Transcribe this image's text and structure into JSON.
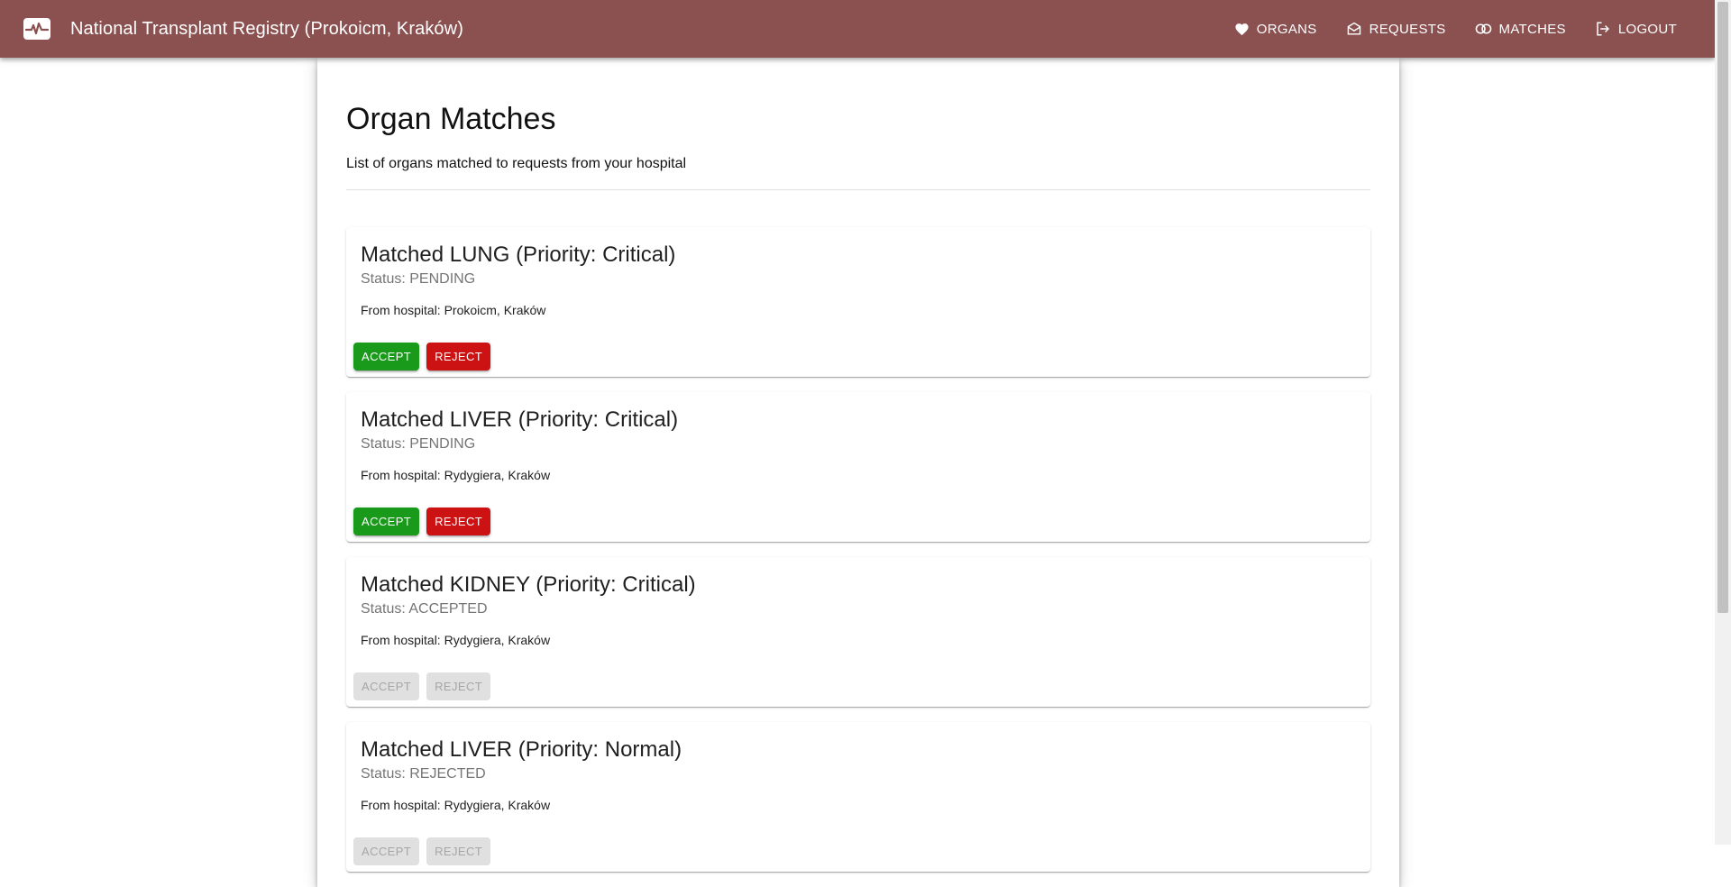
{
  "appbar": {
    "title": "National Transplant Registry (Prokoicm, Kraków)",
    "logo_icon": "heart-monitor-icon",
    "nav": [
      {
        "label": "ORGANS",
        "icon": "heart-icon"
      },
      {
        "label": "REQUESTS",
        "icon": "open-mail-icon"
      },
      {
        "label": "MATCHES",
        "icon": "matches-icon"
      },
      {
        "label": "LOGOUT",
        "icon": "logout-icon"
      }
    ],
    "color": "#8b5050"
  },
  "page": {
    "title": "Organ Matches",
    "subtitle": "List of organs matched to requests from your hospital"
  },
  "matches": [
    {
      "title": "Matched LUNG (Priority: Critical)",
      "status": "Status: PENDING",
      "hospital": "From hospital: Prokoicm, Kraków",
      "accept_label": "ACCEPT",
      "reject_label": "REJECT",
      "actions_enabled": true
    },
    {
      "title": "Matched LIVER (Priority: Critical)",
      "status": "Status: PENDING",
      "hospital": "From hospital: Rydygiera, Kraków",
      "accept_label": "ACCEPT",
      "reject_label": "REJECT",
      "actions_enabled": true
    },
    {
      "title": "Matched KIDNEY (Priority: Critical)",
      "status": "Status: ACCEPTED",
      "hospital": "From hospital: Rydygiera, Kraków",
      "accept_label": "ACCEPT",
      "reject_label": "REJECT",
      "actions_enabled": false
    },
    {
      "title": "Matched LIVER (Priority: Normal)",
      "status": "Status: REJECTED",
      "hospital": "From hospital: Rydygiera, Kraków",
      "accept_label": "ACCEPT",
      "reject_label": "REJECT",
      "actions_enabled": false
    }
  ],
  "colors": {
    "accept": "#1a9a1a",
    "reject": "#cc1212",
    "disabled": "#e0e0e0"
  }
}
